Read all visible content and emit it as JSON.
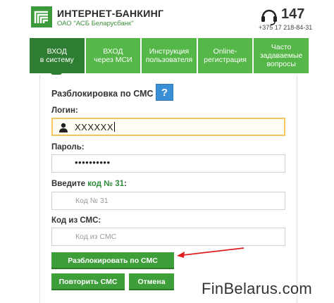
{
  "header": {
    "brand_title": "ИНТЕРНЕТ-БАНКИНГ",
    "brand_sub": "ОАО \"АСБ Беларусбанк\"",
    "phone_short": "147",
    "phone_full": "+375 17 218-84-31",
    "logo_icon": "belarusbank-logo",
    "phone_icon": "headset-icon"
  },
  "tabs": [
    {
      "line1": "ВХОД",
      "line2": "в систему",
      "active": true
    },
    {
      "line1": "ВХОД",
      "line2": "через МСИ",
      "active": false
    },
    {
      "line1": "Инструкция",
      "line2": "пользователя",
      "active": false
    },
    {
      "line1": "Online-",
      "line2": "регистрация",
      "active": false
    },
    {
      "line1": "Часто",
      "line2": "задаваемые",
      "line3": "вопросы",
      "active": false
    }
  ],
  "form": {
    "title": "Разблокировка по СМС",
    "help_label": "?",
    "login_label": "Логин:",
    "login_value": "XXXXXX",
    "password_label": "Пароль:",
    "password_value": "••••••••••",
    "code_label_prefix": "Введите",
    "code_label_code": "код № 31",
    "code_label_suffix": ":",
    "code_placeholder": "Код № 31",
    "sms_label": "Код из СМС:",
    "sms_placeholder": "Код из СМС"
  },
  "buttons": {
    "unlock": "Разблокировать по СМС",
    "repeat": "Повторить СМС",
    "cancel": "Отмена"
  },
  "colors": {
    "brand_green": "#54b747",
    "active_tab": "#2e7d32",
    "button_green": "#3e9e3a",
    "help_blue": "#3a8fd6",
    "focus_border": "#f0c75e",
    "annotation_red": "#e02020"
  },
  "watermark": "FinBelarus.com"
}
